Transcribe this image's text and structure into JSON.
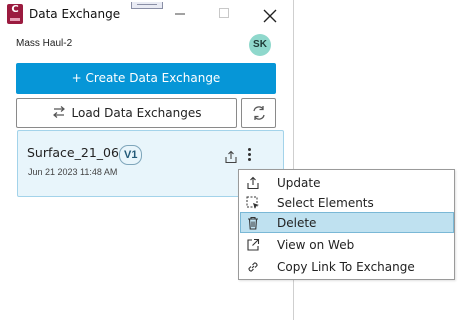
{
  "window": {
    "title": "Data Exchange",
    "app_icon_letter": "C",
    "accent_color": "#9b1b3f"
  },
  "header": {
    "project_name": "Mass Haul-2",
    "user_initials": "SK",
    "avatar_color": "#8fd8cc"
  },
  "actions": {
    "create_label": "+ Create Data Exchange",
    "create_color": "#0696d7",
    "load_label": "Load Data Exchanges",
    "load_icon": "swap-arrows-icon",
    "refresh_icon": "refresh-icon"
  },
  "exchange": {
    "name": "Surface_21_06",
    "version": "V1",
    "date": "Jun 21 2023 11:48 AM",
    "share_icon": "share-upload-icon",
    "more_icon": "more-vertical-icon"
  },
  "context_menu": {
    "items": [
      {
        "label": "Update",
        "icon": "upload-icon",
        "selected": false
      },
      {
        "label": "Select Elements",
        "icon": "select-elements-icon",
        "selected": false
      },
      {
        "label": "Delete",
        "icon": "trash-icon",
        "selected": true
      },
      {
        "label": "View on Web",
        "icon": "external-link-icon",
        "selected": false
      },
      {
        "label": "Copy Link To Exchange",
        "icon": "link-icon",
        "selected": false
      }
    ]
  }
}
